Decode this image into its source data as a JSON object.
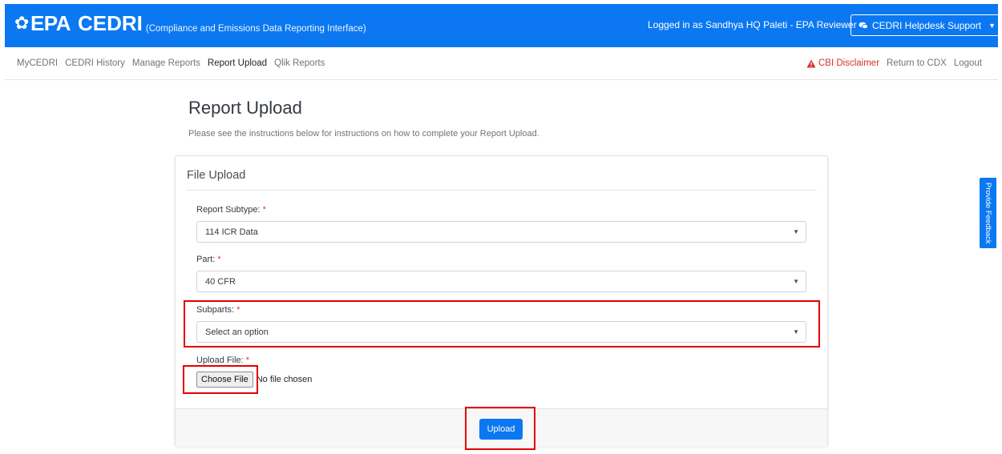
{
  "header": {
    "logo_text": "EPA",
    "app_name": "CEDRI",
    "app_subtitle": "(Compliance and Emissions Data Reporting Interface)",
    "logged_in_text": "Logged in as Sandhya HQ Paleti - EPA Reviewer",
    "helpdesk_label": "CEDRI Helpdesk Support",
    "brand_color": "#0b78f2"
  },
  "nav": {
    "left_items": [
      {
        "label": "MyCEDRI"
      },
      {
        "label": "CEDRI History"
      },
      {
        "label": "Manage Reports"
      },
      {
        "label": "Report Upload",
        "active": true
      },
      {
        "label": "Qlik Reports"
      }
    ],
    "cbi_disclaimer": "CBI Disclaimer",
    "return_to_cdx": "Return to CDX",
    "logout": "Logout"
  },
  "page": {
    "title": "Report Upload",
    "instructions": "Please see the instructions below for instructions on how to complete your Report Upload."
  },
  "form": {
    "card_title": "File Upload",
    "report_subtype": {
      "label": "Report Subtype:",
      "required_mark": "*",
      "value": "114 ICR Data"
    },
    "part": {
      "label": "Part:",
      "required_mark": "*",
      "value": "40 CFR"
    },
    "subparts": {
      "label": "Subparts:",
      "required_mark": "*",
      "value": "Select an option"
    },
    "upload_file": {
      "label": "Upload File:",
      "required_mark": "*",
      "choose_label": "Choose File",
      "status": "No file chosen"
    },
    "upload_button": "Upload"
  },
  "feedback_tab": "Provide Feedback",
  "colors": {
    "primary": "#0b78f2",
    "required": "#e3342f",
    "highlight": "#e00000",
    "cbi": "#d9302f"
  }
}
